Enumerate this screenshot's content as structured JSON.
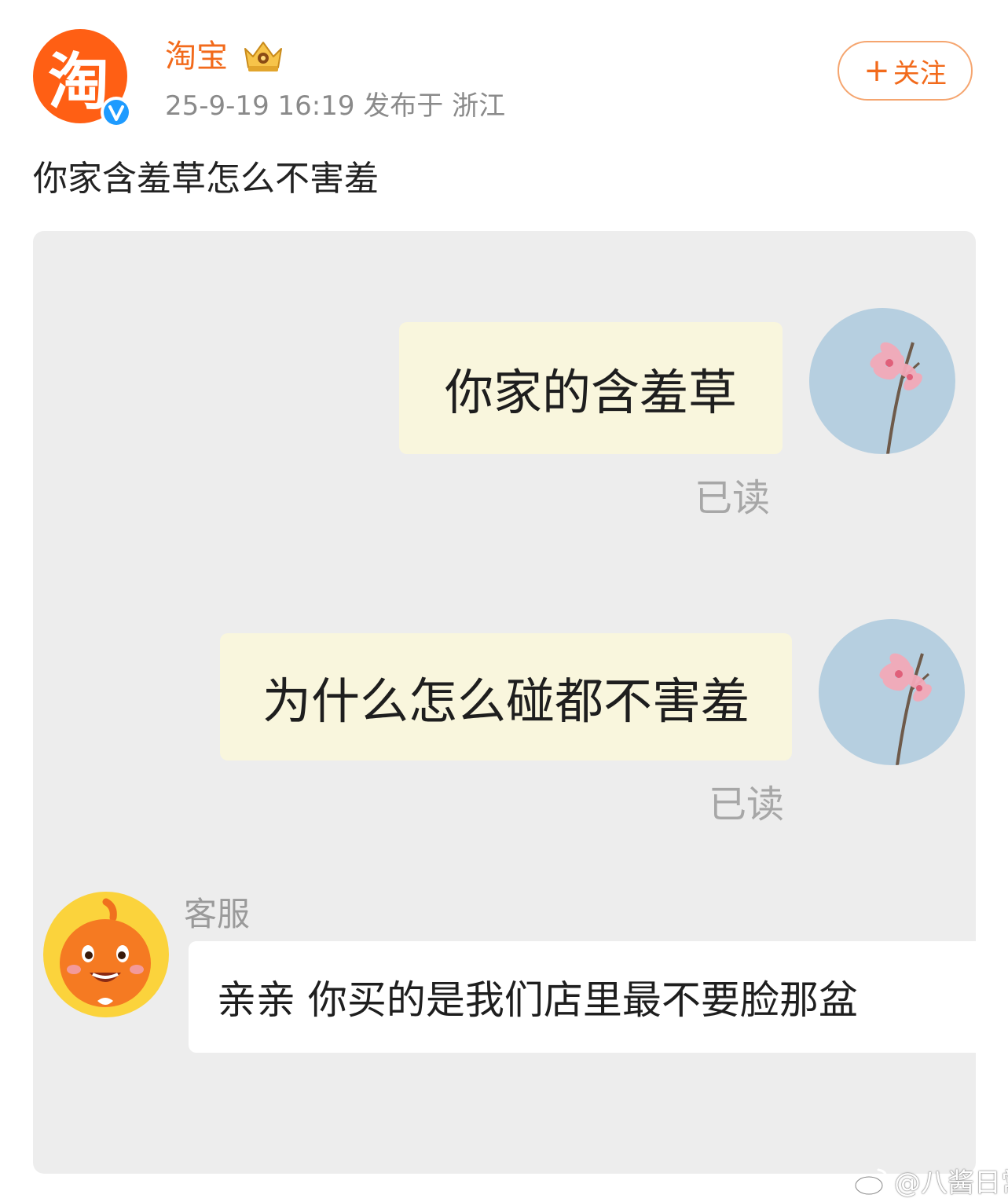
{
  "post": {
    "author": "淘宝",
    "meta": "25-9-19 16:19  发布于 浙江",
    "follow_label": "关注",
    "text": "你家含羞草怎么不害羞"
  },
  "chat": {
    "messages_sent": [
      {
        "text": "你家的含羞草",
        "status": "已读"
      },
      {
        "text": "为什么怎么碰都不害羞",
        "status": "已读"
      }
    ],
    "agent_name": "客服",
    "reply": "亲亲 你买的是我们店里最不要脸那盆"
  },
  "watermark": "@八酱日常",
  "colors": {
    "brand_orange": "#f26a1b",
    "verified_blue": "#1e9bff",
    "chat_background": "#ededed",
    "sent_bubble": "#f9f6dd",
    "received_bubble": "#ffffff",
    "read_status": "#a7a7a7"
  },
  "icons": {
    "author_avatar": "taobao-logo-icon",
    "verified_badge": "verified-v-icon",
    "level_badge": "crown-badge-icon",
    "follow": "plus-icon",
    "user_avatar": "pink-flower-avatar-icon",
    "agent_avatar": "taobao-mascot-icon",
    "watermark": "weibo-logo-icon"
  }
}
